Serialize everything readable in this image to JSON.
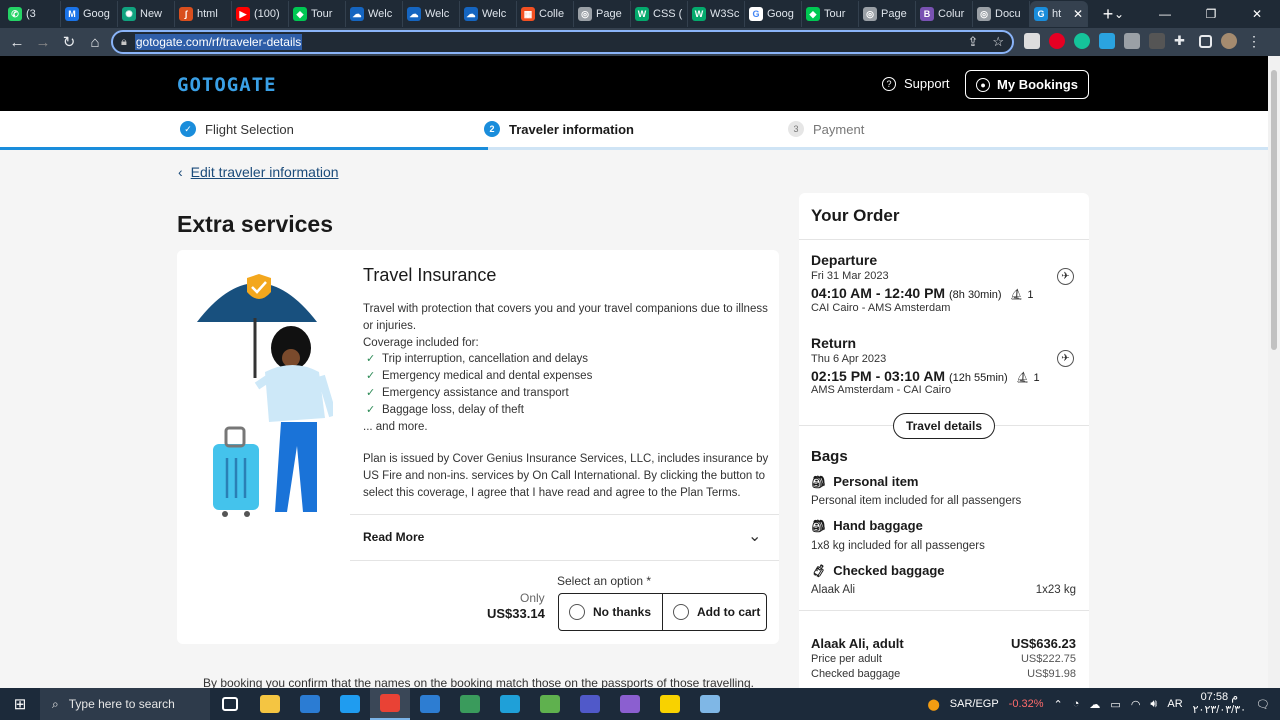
{
  "browser": {
    "tabs": [
      {
        "label": "(3",
        "color": "#25d366",
        "glyph": "✆"
      },
      {
        "label": "Goog",
        "color": "#1a73e8",
        "glyph": "M"
      },
      {
        "label": "New",
        "color": "#10a37f",
        "glyph": "✺"
      },
      {
        "label": "html",
        "color": "#d94f1e",
        "glyph": "∫"
      },
      {
        "label": "(100)",
        "color": "#ff0000",
        "glyph": "▶"
      },
      {
        "label": "Tour",
        "color": "#00c853",
        "glyph": "◆"
      },
      {
        "label": "Welc",
        "color": "#1565c0",
        "glyph": "☁"
      },
      {
        "label": "Welc",
        "color": "#1565c0",
        "glyph": "☁"
      },
      {
        "label": "Welc",
        "color": "#1565c0",
        "glyph": "☁"
      },
      {
        "label": "Colle",
        "color": "#f25022",
        "glyph": "▦"
      },
      {
        "label": "Page",
        "color": "#9aa0a6",
        "glyph": "◎"
      },
      {
        "label": "CSS (",
        "color": "#04aa6d",
        "glyph": "W"
      },
      {
        "label": "W3Sc",
        "color": "#04aa6d",
        "glyph": "W"
      },
      {
        "label": "Goog",
        "color": "#ffffff",
        "glyph": "G"
      },
      {
        "label": "Tour",
        "color": "#00c853",
        "glyph": "◆"
      },
      {
        "label": "Page",
        "color": "#9aa0a6",
        "glyph": "◎"
      },
      {
        "label": "Colur",
        "color": "#7952b3",
        "glyph": "B"
      },
      {
        "label": "Docu",
        "color": "#9aa0a6",
        "glyph": "◎"
      },
      {
        "label": "ht",
        "color": "#1a8ddb",
        "glyph": "G",
        "active": true
      }
    ],
    "new_tab": "+",
    "url": "gotogate.com/rf/traveler-details"
  },
  "site": {
    "logo": "GOTOGATE",
    "support": "Support",
    "my_bookings": "My Bookings"
  },
  "steps": [
    {
      "num": "✓",
      "label": "Flight Selection",
      "state": "done"
    },
    {
      "num": "2",
      "label": "Traveler information",
      "state": "current"
    },
    {
      "num": "3",
      "label": "Payment",
      "state": "upcoming"
    }
  ],
  "progress_fraction": 0.385,
  "main": {
    "edit_link": "Edit traveler information",
    "heading": "Extra services",
    "insurance": {
      "title": "Travel Insurance",
      "intro": "Travel with protection that covers you and your travel companions due to illness or injuries.",
      "coverage_label": "Coverage included for:",
      "items": [
        "Trip interruption, cancellation and delays",
        "Emergency medical and dental expenses",
        "Emergency assistance and transport",
        "Baggage loss, delay of theft"
      ],
      "more": "... and more.",
      "plan": "Plan is issued by Cover Genius Insurance Services, LLC, includes insurance by US Fire and non-ins. services by On Call International. By clicking the button to select this coverage, I agree that I have read and agree to the Plan Terms.",
      "read_more": "Read More",
      "select_label": "Select an option *",
      "only": "Only",
      "price": "US$33.14",
      "no_thanks": "No thanks",
      "add_to_cart": "Add to cart"
    },
    "disclaimer": "By booking you confirm that the names on the booking match those on the passports of those travelling."
  },
  "order": {
    "title": "Your Order",
    "departure": {
      "label": "Departure",
      "date": "Fri 31 Mar 2023",
      "times": "04:10 AM - 12:40 PM",
      "duration": "(8h 30min)",
      "stops": "1",
      "route": "CAI Cairo - AMS Amsterdam"
    },
    "return": {
      "label": "Return",
      "date": "Thu 6 Apr 2023",
      "times": "02:15 PM - 03:10 AM",
      "duration": "(12h 55min)",
      "stops": "1",
      "route": "AMS Amsterdam - CAI Cairo"
    },
    "travel_details": "Travel details",
    "bags": {
      "title": "Bags",
      "personal": {
        "label": "Personal item",
        "desc": "Personal item included for all passengers"
      },
      "hand": {
        "label": "Hand baggage",
        "desc": "1x8 kg included for all passengers"
      },
      "checked": {
        "label": "Checked baggage",
        "name": "Alaak Ali",
        "value": "1x23 kg"
      }
    },
    "passenger": {
      "label": "Alaak Ali, adult",
      "total": "US$636.23",
      "rows": [
        {
          "label": "Price per adult",
          "value": "US$222.75"
        },
        {
          "label": "Checked baggage",
          "value": "US$91.98"
        }
      ]
    }
  },
  "taskbar": {
    "search_placeholder": "Type here to search",
    "apps": [
      {
        "name": "task-view",
        "color": "#ffffff"
      },
      {
        "name": "file-explorer",
        "color": "#f4c542"
      },
      {
        "name": "mail",
        "color": "#2b7cd3"
      },
      {
        "name": "vscode",
        "color": "#1f9cf0"
      },
      {
        "name": "chrome",
        "color": "#e94235",
        "active": true
      },
      {
        "name": "app-blue",
        "color": "#2d7dd2"
      },
      {
        "name": "app-sheet",
        "color": "#3a9b5c"
      },
      {
        "name": "edge",
        "color": "#1fa0d8"
      },
      {
        "name": "app-green",
        "color": "#5fb14e"
      },
      {
        "name": "teams",
        "color": "#5059c9"
      },
      {
        "name": "visual-studio",
        "color": "#8b5fd0"
      },
      {
        "name": "sticky-notes",
        "color": "#f8d200"
      },
      {
        "name": "app-clip",
        "color": "#7fb7e6"
      }
    ],
    "lang": "AR",
    "currency_pair": "SAR/EGP",
    "change": "-0.32%",
    "time": "07:58 م",
    "date": "٢٠٢٣/٠٣/٣٠"
  }
}
